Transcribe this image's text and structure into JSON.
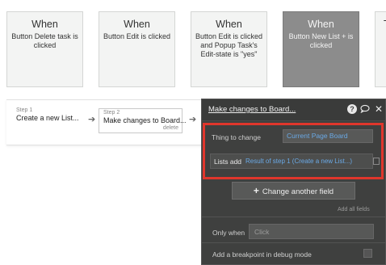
{
  "events": [
    {
      "when": "When",
      "desc": "Button Delete task is clicked"
    },
    {
      "when": "When",
      "desc": "Button Edit is clicked"
    },
    {
      "when": "When",
      "desc": "Button Edit is clicked and Popup Task's Edit-state is \"yes\""
    },
    {
      "when": "When",
      "desc": "Button New List + is clicked"
    },
    {
      "when": "T"
    }
  ],
  "steps": [
    {
      "num": "Step 1",
      "name": "Create a new List..."
    },
    {
      "num": "Step 2",
      "name": "Make changes to Board...",
      "delete": "delete"
    }
  ],
  "panel": {
    "title": "Make changes to Board...",
    "help_icon": "?",
    "thing_label": "Thing to change",
    "thing_value": "Current Page Board",
    "lists_label": "Lists add",
    "lists_value": "Result of step 1 (Create a new List...)",
    "change_field_label": "Change another field",
    "add_all_fields": "Add all fields",
    "only_when_label": "Only when",
    "only_when_placeholder": "Click",
    "breakpoint_label": "Add a breakpoint in debug mode"
  },
  "colors": {
    "highlight": "#e0362c",
    "panel_bg": "#3f403f",
    "link_blue": "#6aa9e6",
    "selected_card": "#8c8c8c"
  }
}
